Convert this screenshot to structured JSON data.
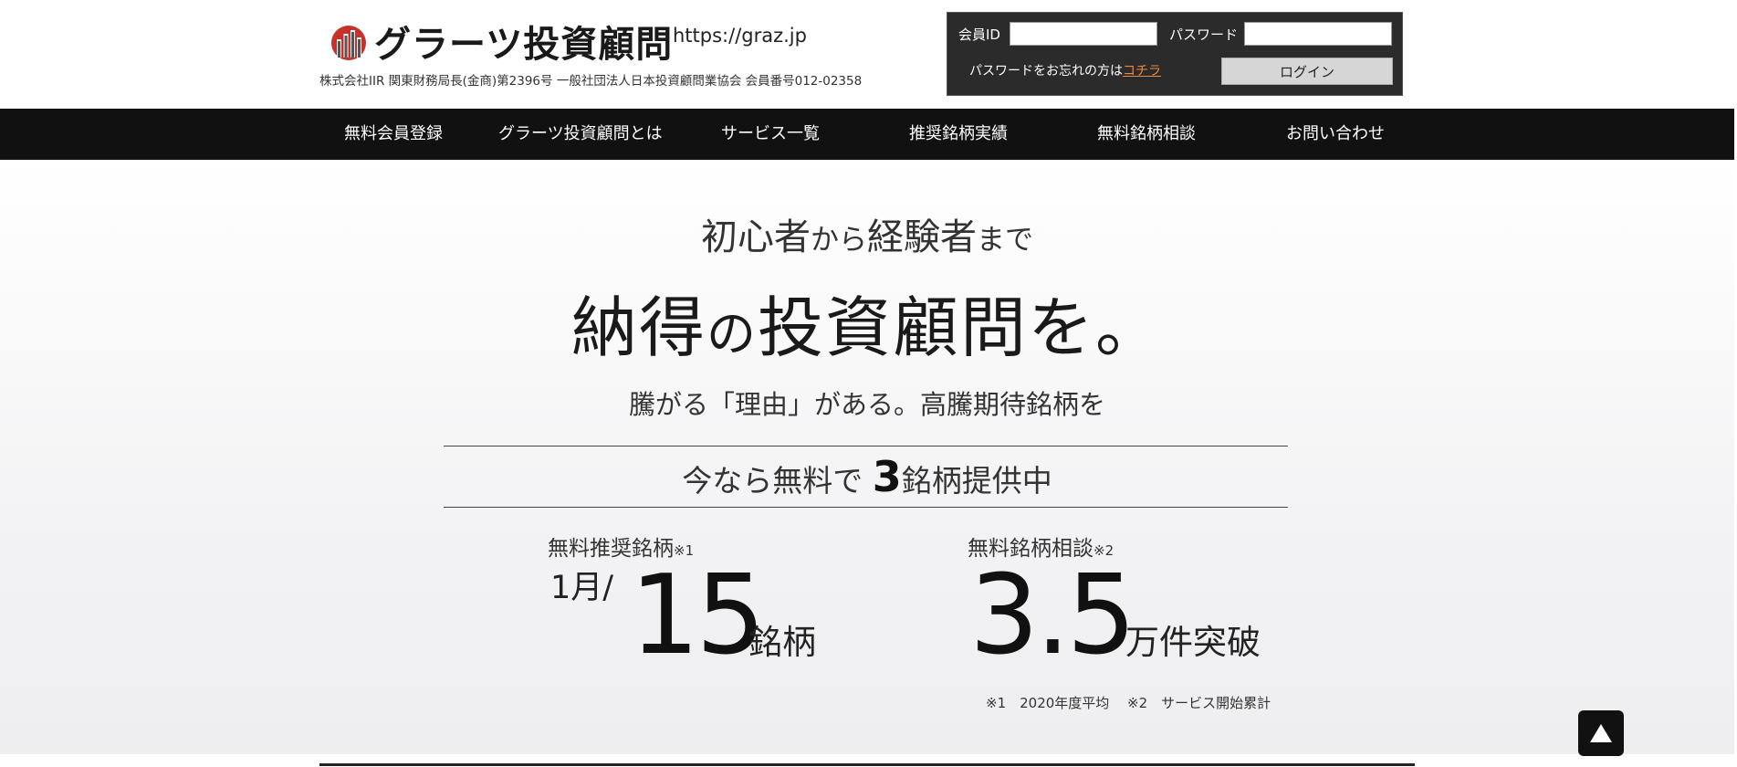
{
  "header": {
    "logo_text": "グラーツ投資顧問",
    "site_url": "https://graz.jp",
    "company_info": "株式会社IIR 関東財務局長(金商)第2396号 一般社団法人日本投資顧問業協会 会員番号012-02358"
  },
  "login": {
    "member_id_label": "会員ID",
    "member_id_value": "",
    "password_label": "パスワード",
    "password_value": "",
    "forgot_prefix": "パスワードをお忘れの方は",
    "forgot_link": "コチラ",
    "login_button": "ログイン"
  },
  "nav": {
    "items": [
      {
        "label": "無料会員登録"
      },
      {
        "label": "グラーツ投資顧問とは"
      },
      {
        "label": "サービス一覧"
      },
      {
        "label": "推奨銘柄実績"
      },
      {
        "label": "無料銘柄相談"
      },
      {
        "label": "お問い合わせ"
      }
    ]
  },
  "hero": {
    "line1_a": "初心者",
    "line1_b": "から",
    "line1_c": "経験者",
    "line1_d": "まで",
    "title_a": "納得",
    "title_b": "の",
    "title_c": "投資顧問",
    "title_d": "を。",
    "subtitle": "騰がる「理由」がある。高騰期待銘柄を",
    "offer_prefix": "今なら無料で ",
    "offer_number": "3",
    "offer_suffix": "銘柄提供中"
  },
  "stats": {
    "left": {
      "label": "無料推奨銘柄",
      "note": "※1",
      "prefix": "1月/",
      "value": "15",
      "unit": "銘柄"
    },
    "right": {
      "label": "無料銘柄相談",
      "note": "※2",
      "value": "3.5",
      "unit": "万件突破"
    },
    "footnotes": "※1　2020年度平均　 ※2　サービス開始累計"
  },
  "colors": {
    "nav_bg": "#111111",
    "login_bg": "#2b2b2b",
    "link_accent": "#f08a3c",
    "logo_red": "#c8302a"
  },
  "icons": {
    "logo": "graz-logo-icon",
    "back_to_top": "triangle-up-icon"
  }
}
